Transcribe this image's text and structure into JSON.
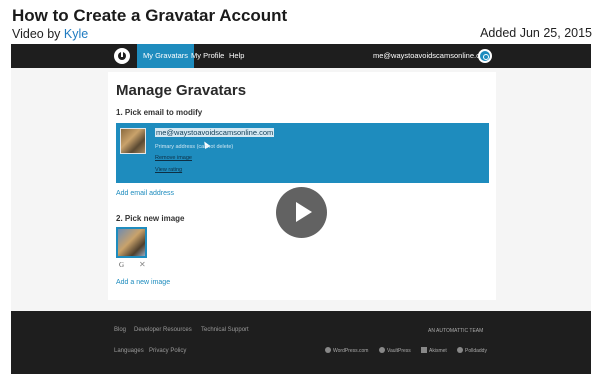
{
  "page": {
    "title": "How to Create a Gravatar Account",
    "video_by_prefix": "Video by ",
    "author": "Kyle",
    "added": "Added Jun 25, 2015"
  },
  "nav": {
    "tabs": [
      "My Gravatars",
      "My Profile",
      "Help"
    ],
    "active_tab": "My Gravatars",
    "email": "me@waystoavoidscamsonline.com"
  },
  "main": {
    "title": "Manage Gravatars",
    "step1": "1. Pick email to modify",
    "email": "me@waystoavoidscamsonline.com",
    "email_note": "Primary address (cannot delete)",
    "remove_image": "Remove image",
    "view_rating": "View rating",
    "add_email": "Add email address",
    "step2": "2. Pick new image",
    "thumb_g": "G",
    "thumb_x": "✕",
    "add_image": "Add a new image"
  },
  "footer": {
    "links_row1": [
      "Blog",
      "Developer Resources",
      "Technical Support"
    ],
    "links_row2": [
      "Languages",
      "Privacy Policy"
    ],
    "brand": "AN AUTOMATTIC TEAM",
    "partners": [
      "WordPress.com",
      "VaultPress",
      "Akismet",
      "Polldaddy"
    ]
  },
  "player": {
    "play_icon": "play-icon"
  },
  "colors": {
    "accent": "#1e8cbe",
    "dark_bar": "#1e1e1e",
    "link": "#1f7bc1"
  }
}
